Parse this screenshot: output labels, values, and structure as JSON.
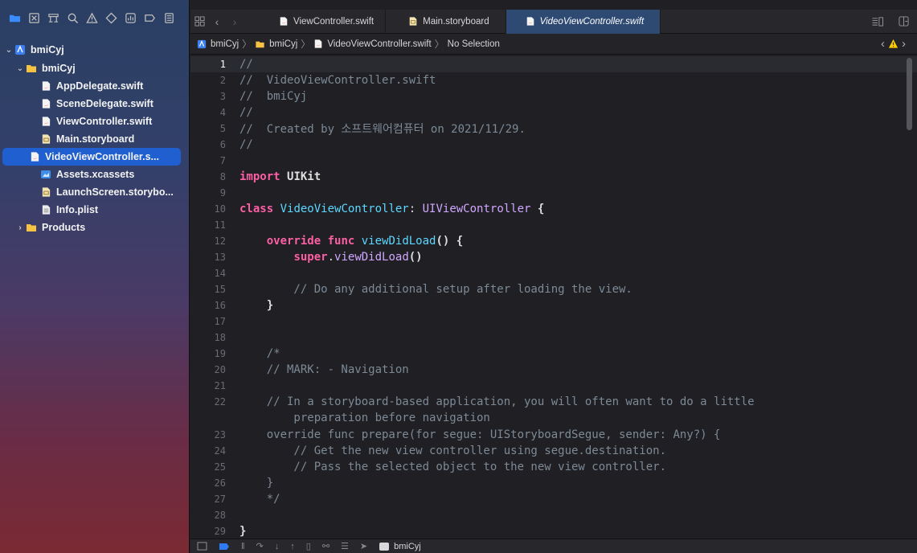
{
  "navigator": {
    "toolbar_icons": [
      "folder-icon",
      "source-control-icon",
      "hierarchy-icon",
      "find-icon",
      "warning-icon",
      "test-icon",
      "debug-icon",
      "breakpoint-icon",
      "report-icon"
    ],
    "tree": [
      {
        "label": "bmiCyj",
        "kind": "project",
        "expanded": true
      },
      {
        "label": "bmiCyj",
        "kind": "folder",
        "expanded": true
      },
      {
        "label": "AppDelegate.swift",
        "kind": "swift"
      },
      {
        "label": "SceneDelegate.swift",
        "kind": "swift"
      },
      {
        "label": "ViewController.swift",
        "kind": "swift"
      },
      {
        "label": "Main.storyboard",
        "kind": "storyboard"
      },
      {
        "label": "VideoViewController.s...",
        "kind": "swift",
        "selected": true
      },
      {
        "label": "Assets.xcassets",
        "kind": "assets"
      },
      {
        "label": "LaunchScreen.storybo...",
        "kind": "storyboard"
      },
      {
        "label": "Info.plist",
        "kind": "plist"
      },
      {
        "label": "Products",
        "kind": "folder",
        "expanded": false
      }
    ]
  },
  "tabs": [
    {
      "label": "ViewController.swift",
      "icon": "swift-file-icon"
    },
    {
      "label": "Main.storyboard",
      "icon": "storyboard-icon"
    },
    {
      "label": "VideoViewController.swift",
      "icon": "swift-file-icon",
      "active": true
    }
  ],
  "jumpbar": {
    "project": "bmiCyj",
    "group": "bmiCyj",
    "file": "VideoViewController.swift",
    "selection": "No Selection"
  },
  "code": {
    "current_line": 1,
    "lines": [
      {
        "n": "1",
        "t": "//"
      },
      {
        "n": "2",
        "t": "//  VideoViewController.swift"
      },
      {
        "n": "3",
        "t": "//  bmiCyj"
      },
      {
        "n": "4",
        "t": "//"
      },
      {
        "n": "5",
        "t": "//  Created by 소프트웨어컴퓨터 on 2021/11/29."
      },
      {
        "n": "6",
        "t": "//"
      },
      {
        "n": "7",
        "t": ""
      },
      {
        "n": "8",
        "t": "import UIKit"
      },
      {
        "n": "9",
        "t": ""
      },
      {
        "n": "10",
        "t": "class VideoViewController: UIViewController {"
      },
      {
        "n": "11",
        "t": ""
      },
      {
        "n": "12",
        "t": "    override func viewDidLoad() {"
      },
      {
        "n": "13",
        "t": "        super.viewDidLoad()"
      },
      {
        "n": "14",
        "t": ""
      },
      {
        "n": "15",
        "t": "        // Do any additional setup after loading the view."
      },
      {
        "n": "16",
        "t": "    }"
      },
      {
        "n": "17",
        "t": ""
      },
      {
        "n": "18",
        "t": ""
      },
      {
        "n": "19",
        "t": "    /*"
      },
      {
        "n": "20",
        "t": "    // MARK: - Navigation"
      },
      {
        "n": "21",
        "t": ""
      },
      {
        "n": "22",
        "t": "    // In a storyboard-based application, you will often want to do a little"
      },
      {
        "n": "",
        "t": "        preparation before navigation"
      },
      {
        "n": "23",
        "t": "    override func prepare(for segue: UIStoryboardSegue, sender: Any?) {"
      },
      {
        "n": "24",
        "t": "        // Get the new view controller using segue.destination."
      },
      {
        "n": "25",
        "t": "        // Pass the selected object to the new view controller."
      },
      {
        "n": "26",
        "t": "    }"
      },
      {
        "n": "27",
        "t": "    */"
      },
      {
        "n": "28",
        "t": ""
      },
      {
        "n": "29",
        "t": "}"
      }
    ]
  },
  "debugbar": {
    "scheme": "bmiCyj"
  },
  "colors": {
    "keyword": "#fc5fa3",
    "type": "#d0a8ff",
    "class_name": "#5dd8ff",
    "function": "#67b7a4",
    "comment": "#7d8a96",
    "selection": "#1f5fd0",
    "active_tab": "#2e4a73",
    "warning": "#ffcc00"
  }
}
